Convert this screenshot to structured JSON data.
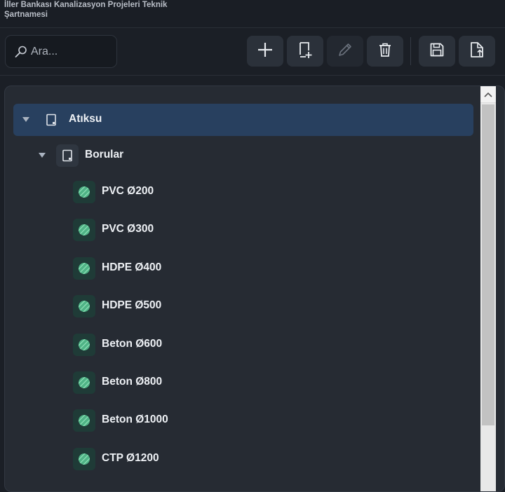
{
  "app": {
    "title": "İller Bankası Kanalizasyon Projeleri Teknik Şartnamesi"
  },
  "search": {
    "placeholder": "Ara..."
  },
  "toolbar": {
    "buttons": [
      {
        "name": "add",
        "icon": "plus-icon",
        "enabled": true
      },
      {
        "name": "add-child",
        "icon": "add-document-icon",
        "enabled": true
      },
      {
        "name": "edit",
        "icon": "pencil-icon",
        "enabled": false
      },
      {
        "name": "delete",
        "icon": "trash-icon",
        "enabled": true
      },
      {
        "name": "save",
        "icon": "floppy-disk-icon",
        "enabled": true
      },
      {
        "name": "export",
        "icon": "export-document-icon",
        "enabled": true
      }
    ]
  },
  "tree": {
    "root": {
      "label": "Atıksu",
      "expanded": true,
      "selected": true
    },
    "group": {
      "label": "Borular",
      "expanded": true
    },
    "items": [
      {
        "label": "PVC Ø200"
      },
      {
        "label": "PVC Ø300"
      },
      {
        "label": "HDPE Ø400"
      },
      {
        "label": "HDPE Ø500"
      },
      {
        "label": "Beton Ø600"
      },
      {
        "label": "Beton Ø800"
      },
      {
        "label": "Beton Ø1000"
      },
      {
        "label": "CTP Ø1200"
      }
    ]
  },
  "colors": {
    "background": "#1b1f26",
    "panel": "#262b33",
    "selection": "#28405f",
    "item_icon": "#5fc99a",
    "text": "#eef1f5"
  }
}
